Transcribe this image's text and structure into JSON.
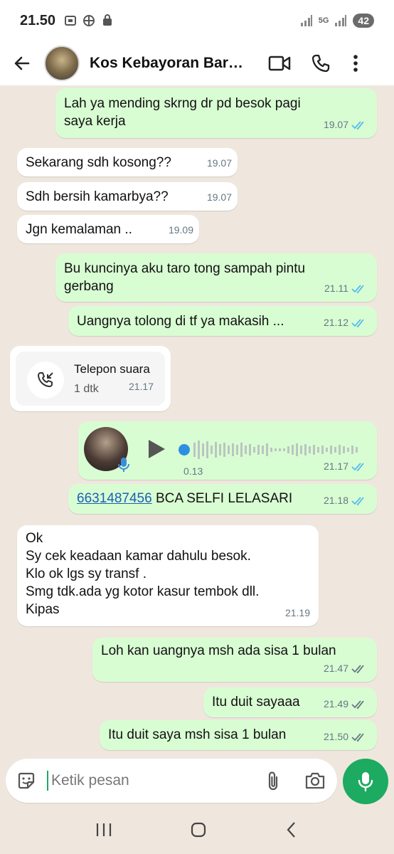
{
  "status_bar": {
    "time": "21.50",
    "battery": "42",
    "network": "5G"
  },
  "header": {
    "title": "Kos Kebayoran Baru..."
  },
  "messages": [
    {
      "dir": "out",
      "lines": [
        "Lah ya mending skrng dr pd  besok pagi",
        "saya kerja"
      ],
      "time": "19.07",
      "read": true
    },
    {
      "dir": "in",
      "lines": [
        "Sekarang sdh kosong??"
      ],
      "time": "19.07"
    },
    {
      "dir": "in",
      "lines": [
        "Sdh bersih  kamarbya??"
      ],
      "time": "19.07"
    },
    {
      "dir": "in",
      "lines": [
        "Jgn kemalaman .."
      ],
      "time": "19.09"
    },
    {
      "dir": "out",
      "lines": [
        "Bu kuncinya aku taro tong sampah pintu",
        "gerbang"
      ],
      "time": "21.11",
      "read": true
    },
    {
      "dir": "out",
      "lines": [
        "Uangnya tolong di tf ya makasih ..."
      ],
      "time": "21.12",
      "read": true
    },
    {
      "dir": "in",
      "type": "call",
      "call_title": "Telepon suara",
      "call_duration": "1 dtk",
      "time": "21.17"
    },
    {
      "dir": "out",
      "type": "voice",
      "duration": "0.13",
      "time": "21.17",
      "read": true
    },
    {
      "dir": "out",
      "link": "6631487456",
      "after_link": " BCA SELFI LELASARI",
      "time": "21.18",
      "read": true
    },
    {
      "dir": "in",
      "lines": [
        "Ok",
        "Sy cek keadaan kamar dahulu besok.",
        "Klo ok lgs sy transf .",
        "Smg tdk.ada yg kotor  kasur  tembok   dll.",
        "Kipas"
      ],
      "time": "21.19"
    },
    {
      "dir": "out",
      "lines": [
        "Loh kan uangnya msh ada sisa 1 bulan"
      ],
      "time": "21.47",
      "read": false
    },
    {
      "dir": "out",
      "lines": [
        "Itu duit sayaaa"
      ],
      "time": "21.49",
      "read": false
    },
    {
      "dir": "out",
      "lines": [
        "Itu duit saya msh sisa 1 bulan"
      ],
      "time": "21.50",
      "read": false
    }
  ],
  "input": {
    "placeholder": "Ketik pesan"
  },
  "colors": {
    "outgoing_bubble": "#d9fdd3",
    "incoming_bubble": "#ffffff",
    "read_tick": "#53bdeb",
    "delivered_tick": "#667781",
    "accent": "#1daa61"
  },
  "icons": [
    "back-arrow-icon",
    "video-call-icon",
    "phone-icon",
    "more-vert-icon",
    "sticker-icon",
    "attach-icon",
    "camera-icon",
    "mic-icon",
    "missed-call-icon",
    "play-icon"
  ]
}
